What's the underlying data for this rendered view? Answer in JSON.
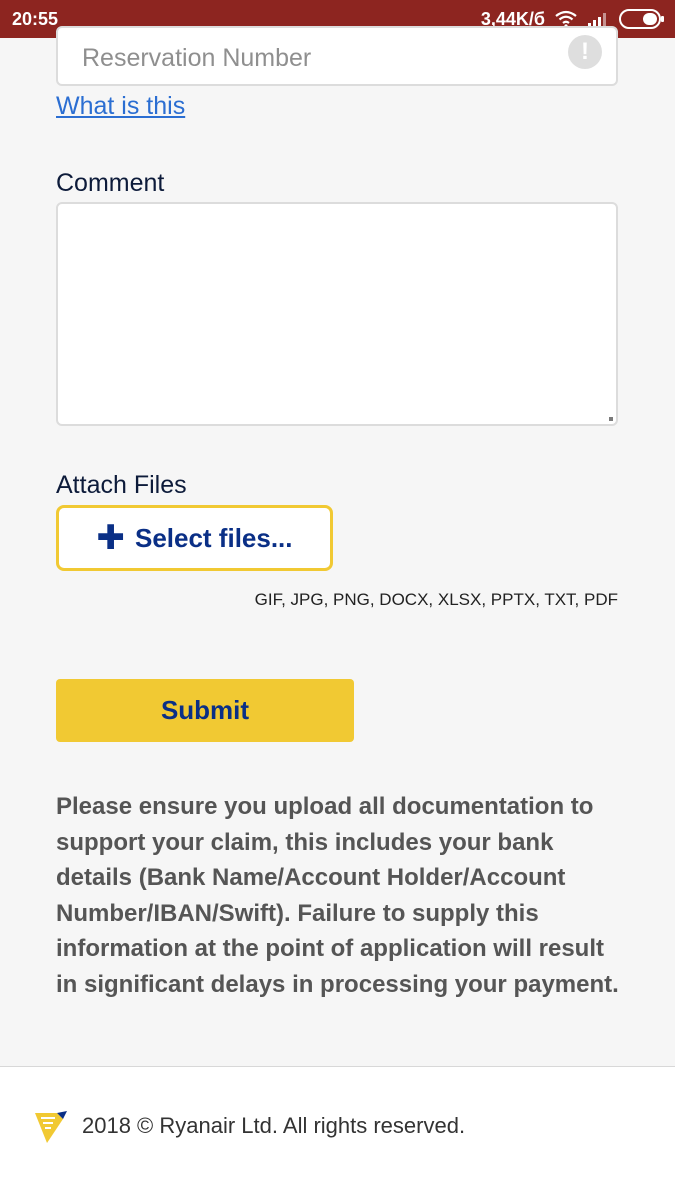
{
  "status_bar": {
    "time": "20:55",
    "network_speed": "3,44K/б"
  },
  "form": {
    "reservation_placeholder": "Reservation Number",
    "what_is_this": "What is this",
    "comment_label": "Comment",
    "comment_value": "",
    "attach_label": "Attach Files",
    "select_files_label": "Select files...",
    "file_formats": "GIF, JPG, PNG, DOCX, XLSX, PPTX, TXT, PDF",
    "submit_label": "Submit",
    "notice": "Please ensure you upload all documentation to support your claim, this includes your bank details (Bank Name/Account Holder/Account Number/IBAN/Swift). Failure to supply this information at the point of application will result in significant delays in processing your payment."
  },
  "footer": {
    "copyright": "2018 © Ryanair Ltd. All rights reserved."
  },
  "colors": {
    "status_bar": "#8d2520",
    "accent_yellow": "#f1c933",
    "brand_blue": "#0a2f86",
    "link": "#2b6ed2"
  },
  "icons": [
    "wifi-icon",
    "signal-icon",
    "battery-icon",
    "alert-icon",
    "plus-icon",
    "ryanair-harp-logo"
  ]
}
